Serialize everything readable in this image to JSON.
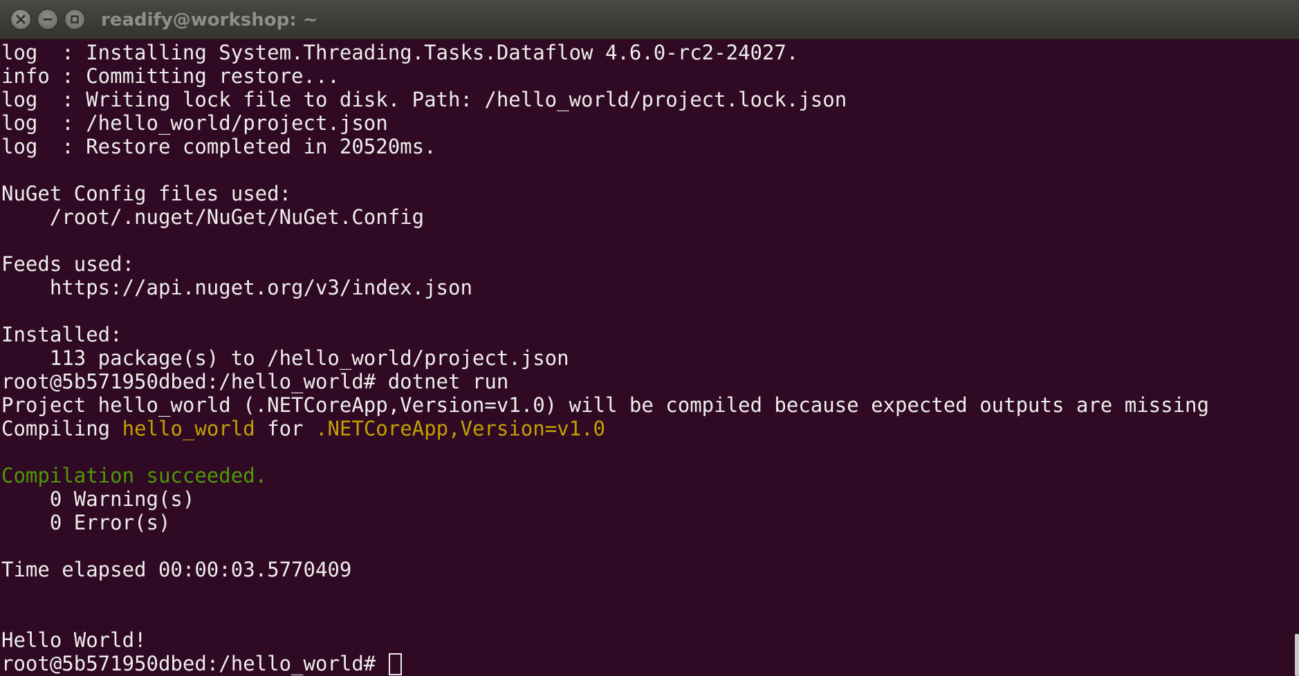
{
  "window": {
    "title": "readify@workshop: ~",
    "close_label": "×",
    "minimize_label": "–",
    "maximize_label": "□"
  },
  "terminal": {
    "lines": [
      "log  : Installing System.Threading.Tasks.Dataflow 4.6.0-rc2-24027.",
      "info : Committing restore...",
      "log  : Writing lock file to disk. Path: /hello_world/project.lock.json",
      "log  : /hello_world/project.json",
      "log  : Restore completed in 20520ms.",
      "",
      "NuGet Config files used:",
      "    /root/.nuget/NuGet/NuGet.Config",
      "",
      "Feeds used:",
      "    https://api.nuget.org/v3/index.json",
      "",
      "Installed:",
      "    113 package(s) to /hello_world/project.json",
      "root@5b571950dbed:/hello_world# dotnet run",
      "Project hello_world (.NETCoreApp,Version=v1.0) will be compiled because expected outputs are missing",
      "",
      "",
      "Compilation succeeded.",
      "    0 Warning(s)",
      "    0 Error(s)",
      "",
      "Time elapsed 00:00:03.5770409",
      "",
      "",
      "Hello World!",
      ""
    ],
    "compiling": {
      "prefix": "Compiling ",
      "project": "hello_world",
      "middle": " for ",
      "framework": ".NETCoreApp,Version=v1.0"
    },
    "prompt": "root@5b571950dbed:/hello_world# "
  },
  "colors": {
    "background": "#300a24",
    "text": "#eeeeec",
    "yellow": "#c4a000",
    "green": "#4e9a06",
    "titlebar": "#3d3c38"
  },
  "icons": {
    "close": "close-icon",
    "minimize": "minimize-icon",
    "maximize": "maximize-icon",
    "cursor": "cursor-block"
  }
}
